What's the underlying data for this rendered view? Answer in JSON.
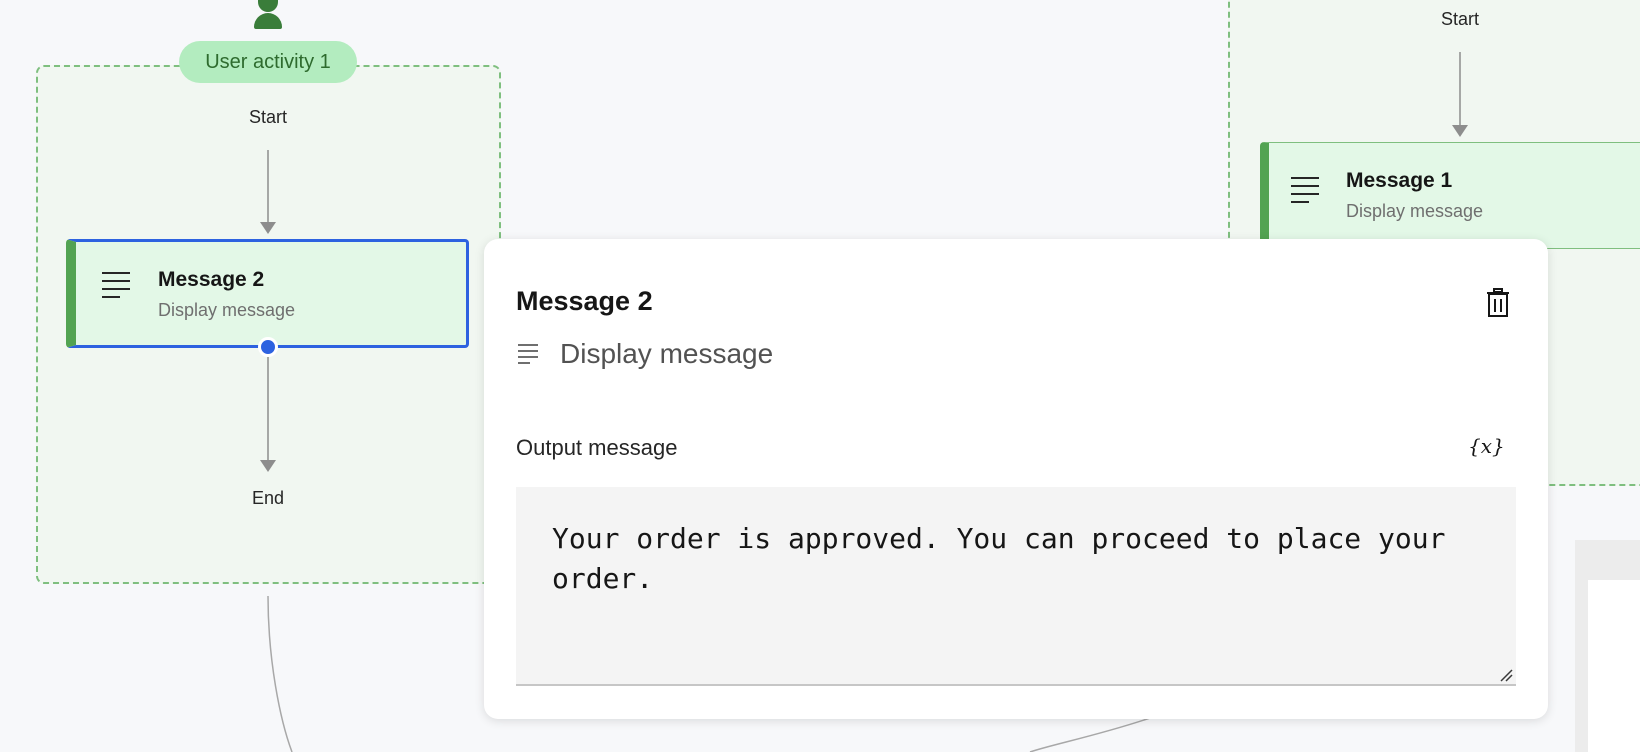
{
  "canvas": {
    "left_group": {
      "activity_label": "User activity 1",
      "start_label": "Start",
      "end_label": "End",
      "node": {
        "title": "Message 2",
        "subtitle": "Display message",
        "icon": "lines-icon"
      }
    },
    "right_group": {
      "start_label": "Start",
      "node": {
        "title": "Message 1",
        "subtitle": "Display message",
        "icon": "lines-icon"
      }
    }
  },
  "popover": {
    "title": "Message 2",
    "type_label": "Display message",
    "delete_icon": "trash-icon",
    "field_label": "Output message",
    "variable_button": "{x}",
    "output_value": "Your order is approved. You can proceed to place your order."
  },
  "colors": {
    "selected_border": "#2d62e0",
    "group_border": "#7fbf7f",
    "node_fill": "#e3f8e7",
    "node_accent": "#52a352",
    "pill_fill": "#b3ecbf"
  }
}
